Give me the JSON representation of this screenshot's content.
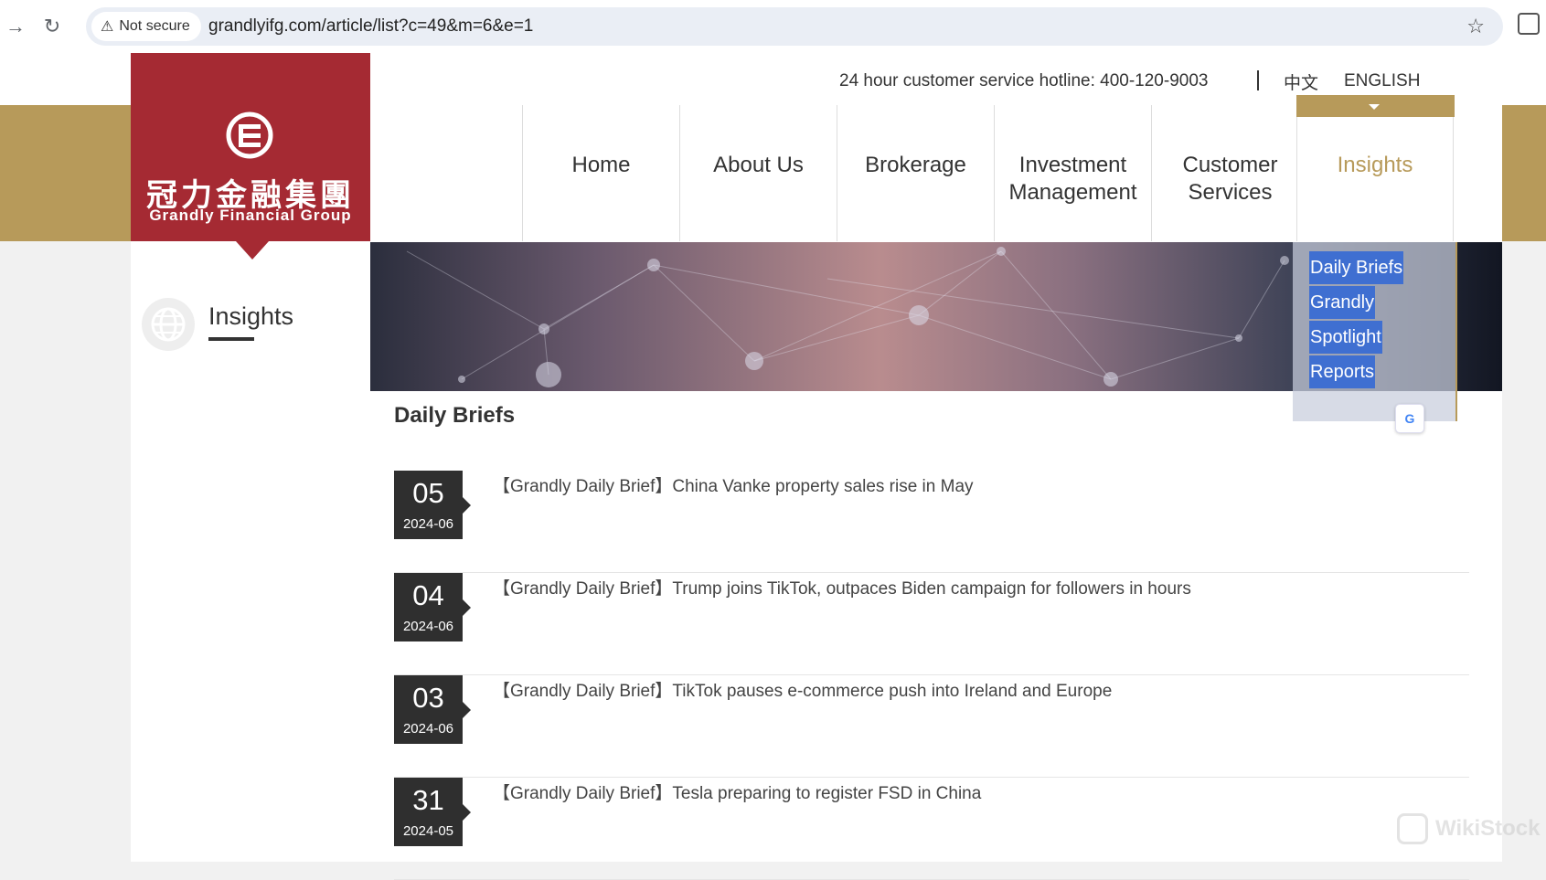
{
  "browser": {
    "security_label": "Not secure",
    "url": "grandlyifg.com/article/list?c=49&m=6&e=1",
    "back_icon": "arrow-right-icon",
    "reload_icon": "reload-icon"
  },
  "header": {
    "logo_cn": "冠力金融集團",
    "logo_en": "Grandly Financial Group",
    "hotline": "24 hour customer service hotline: 400-120-9003",
    "lang_cn": "中文",
    "lang_en": "ENGLISH"
  },
  "nav": {
    "items": [
      {
        "label": "Home"
      },
      {
        "label": "About Us"
      },
      {
        "label": "Brokerage"
      },
      {
        "label": "Investment Management"
      },
      {
        "label": "Customer Services"
      },
      {
        "label": "Insights",
        "active": true
      }
    ]
  },
  "dropdown": {
    "items": [
      "Daily Briefs",
      "Grandly",
      "Spotlight",
      "Reports"
    ]
  },
  "sidebar": {
    "title": "Insights"
  },
  "content": {
    "section_title": "Daily Briefs",
    "articles": [
      {
        "day": "05",
        "ym": "2024-06",
        "title": "【Grandly Daily Brief】China Vanke property sales rise in May"
      },
      {
        "day": "04",
        "ym": "2024-06",
        "title": "【Grandly Daily Brief】Trump joins TikTok, outpaces Biden campaign for followers in hours"
      },
      {
        "day": "03",
        "ym": "2024-06",
        "title": "【Grandly Daily Brief】TikTok pauses e-commerce push into Ireland and Europe"
      },
      {
        "day": "31",
        "ym": "2024-05",
        "title": "【Grandly Daily Brief】Tesla preparing to register FSD in China"
      }
    ]
  },
  "watermark": "WikiStock",
  "colors": {
    "brand_red": "#a52a33",
    "gold": "#b79a5a",
    "date_box": "#2f2f2f",
    "dropdown_highlight": "#3f6fd1"
  }
}
